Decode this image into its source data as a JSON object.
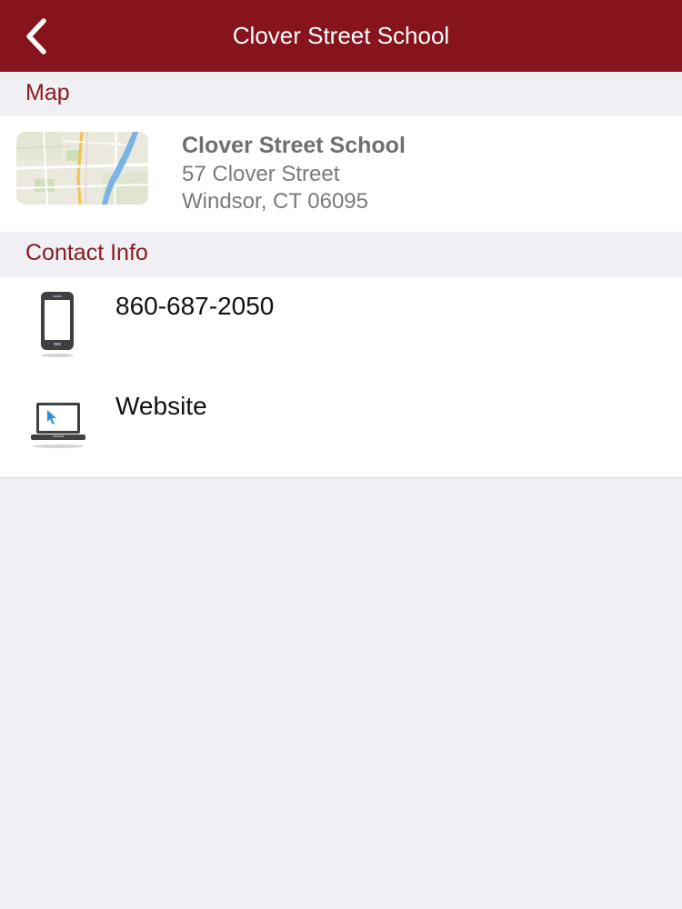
{
  "navbar": {
    "title": "Clover Street School",
    "back_icon": "chevron-left-icon",
    "background": "#87131c"
  },
  "map_section": {
    "header": "Map",
    "thumbnail_icon": "map-thumbnail",
    "name": "Clover Street School",
    "address_line1": "57 Clover Street",
    "address_line2": "Windsor, CT 06095"
  },
  "contact_section": {
    "header": "Contact Info",
    "items": [
      {
        "icon": "phone-icon",
        "label": "860-687-2050"
      },
      {
        "icon": "laptop-icon",
        "label": "Website"
      }
    ]
  },
  "colors": {
    "accent": "#87131c",
    "section_text": "#8a1b22",
    "background": "#efeff4"
  }
}
